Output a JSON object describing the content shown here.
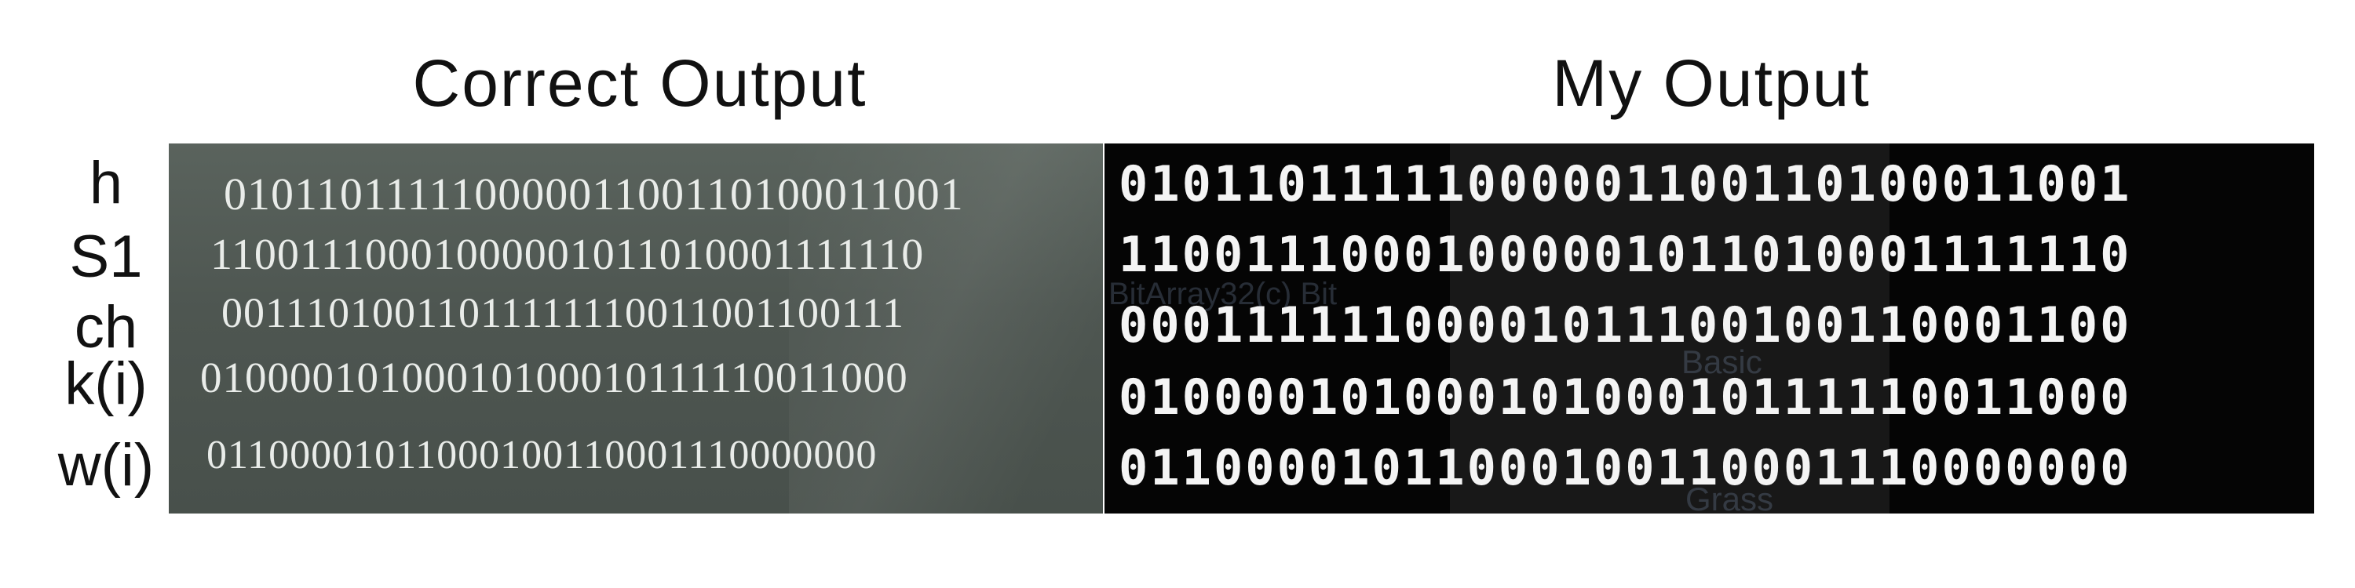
{
  "titles": {
    "left": "Correct Output",
    "right": "My Output"
  },
  "row_labels": [
    "h",
    "S1",
    "ch",
    "k(i)",
    "w(i)"
  ],
  "correct_output": [
    "01011011111000001100110100011001",
    "11001110001000001011010001111110",
    "00111010011011111110011001100111",
    "01000010100010100010111110011000",
    "01100001011000100110001110000000"
  ],
  "my_output": [
    "01011011111000001100110100011001",
    "11001110001000001011010001111110",
    "00011111100001011100100110001100",
    "01000010100010100010111110011000",
    "01100001011000100110001110000000"
  ],
  "background_ghost_text": {
    "code": "BitArray32(c)  Bit",
    "basic": "Basic",
    "grass": "Grass"
  },
  "colors": {
    "left_panel": "#4e5651",
    "right_panel": "#050505",
    "left_text": "#e9ece9",
    "right_text": "#f4f4f4"
  }
}
